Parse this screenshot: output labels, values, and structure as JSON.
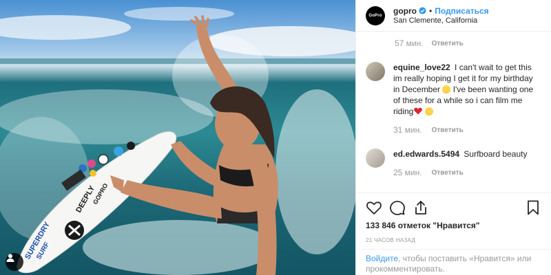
{
  "post": {
    "account": {
      "username": "gopro",
      "follow_label": "Подписаться",
      "location": "San Clemente, California",
      "avatar_text": "GoPro"
    },
    "top_meta": {
      "time": "57 мин.",
      "reply_label": "Ответить"
    },
    "comments": [
      {
        "username": "equine_love22",
        "text_1": " I can't wait to get this im really hoping I get it for my birthday in December",
        "text_2": " I've been wanting one of these for a while so i can film me riding",
        "time": "31 мин.",
        "reply_label": "Ответить"
      },
      {
        "username": "ed.edwards.5494",
        "text_1": " Surfboard beauty",
        "time": "25 мин.",
        "reply_label": "Ответить"
      }
    ],
    "likes": "133 846 отметок \"Нравится\"",
    "time_ago": "21 ЧАСОВ НАЗАД",
    "login_prompt": {
      "link": "Войдите",
      "text": ", чтобы поставить «Нравится» или прокомментировать."
    },
    "board_text": {
      "brand_1": "SUPERDRY",
      "brand_2": "SURF",
      "brand_3": "DEEPLY",
      "brand_4": "GOPRO"
    },
    "icons": [
      "heart-icon",
      "comment-icon",
      "share-icon",
      "bookmark-icon",
      "user-icon",
      "verified-icon"
    ],
    "colors": {
      "accent": "#3897f0",
      "text": "#262626",
      "muted": "#999999",
      "border": "#efefef"
    }
  }
}
